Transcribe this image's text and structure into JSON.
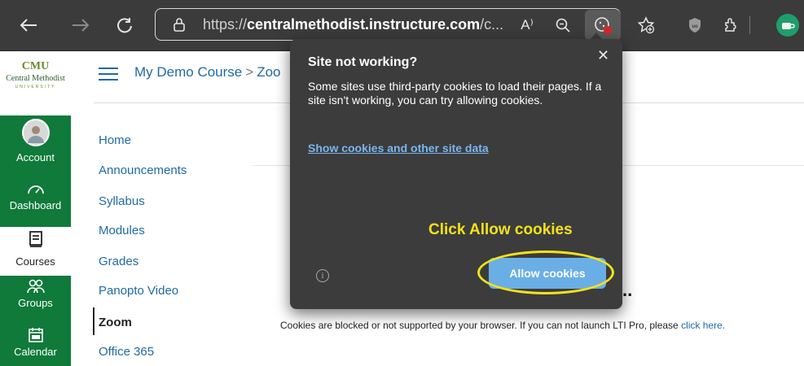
{
  "browser": {
    "url_prefix": "https://",
    "url_domain": "centralmethodist.instructure.com",
    "url_suffix": "/c...",
    "read_aloud": "A⁾"
  },
  "logo": {
    "mark": "CMU",
    "name": "Central Methodist",
    "sub": "UNIVERSITY"
  },
  "global_nav": {
    "account": "Account",
    "dashboard": "Dashboard",
    "courses": "Courses",
    "groups": "Groups",
    "calendar": "Calendar"
  },
  "breadcrumb": {
    "course": "My Demo Course",
    "separator": ">",
    "page": "Zoo"
  },
  "course_nav": [
    "Home",
    "Announcements",
    "Syllabus",
    "Modules",
    "Grades",
    "Panopto Video",
    "Zoom",
    "Office 365"
  ],
  "main": {
    "dots": "..",
    "blocked_text": "Cookies are blocked or not supported by your browser. If you can not launch LTI Pro, please",
    "blocked_link": "click here."
  },
  "popup": {
    "title": "Site not working?",
    "body": "Some sites use third-party cookies to load their pages. If a site isn't working, you can try allowing cookies.",
    "link": "Show cookies and other site data",
    "hint": "Click Allow cookies",
    "allow_button": "Allow cookies",
    "close": "✕",
    "info": "i"
  },
  "colors": {
    "nav_green": "#0f7a3a",
    "link_blue": "#1f6aa5",
    "hint_yellow": "#f4e21a",
    "allow_blue": "#6aaee6"
  }
}
